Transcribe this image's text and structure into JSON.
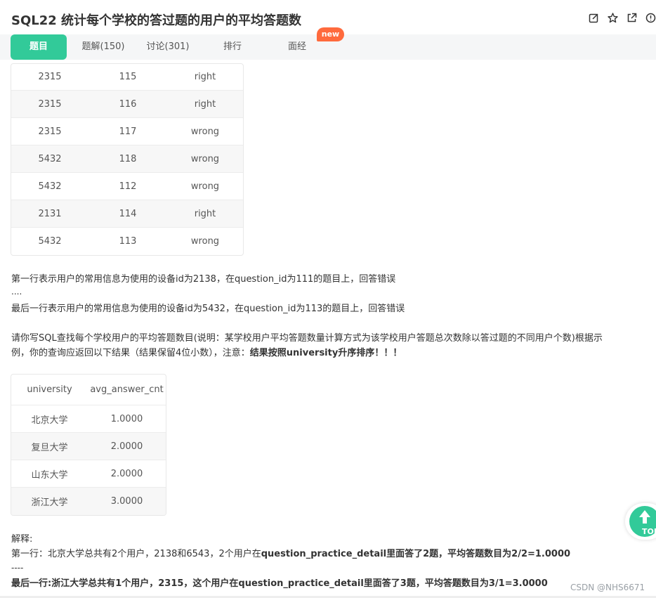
{
  "header": {
    "title": "SQL22  统计每个学校的答过题的用户的平均答题数"
  },
  "header_icons": [
    "edit-icon",
    "star-icon",
    "share-icon",
    "info-icon"
  ],
  "tabs": [
    {
      "label": "题目",
      "active": true
    },
    {
      "label": "题解(150)",
      "active": false
    },
    {
      "label": "讨论(301)",
      "active": false
    },
    {
      "label": "排行",
      "active": false
    },
    {
      "label": "面经",
      "active": false
    }
  ],
  "badge": "new",
  "table1": {
    "rows": [
      [
        "2315",
        "115",
        "right"
      ],
      [
        "2315",
        "116",
        "right"
      ],
      [
        "2315",
        "117",
        "wrong"
      ],
      [
        "5432",
        "118",
        "wrong"
      ],
      [
        "5432",
        "112",
        "wrong"
      ],
      [
        "2131",
        "114",
        "right"
      ],
      [
        "5432",
        "113",
        "wrong"
      ]
    ]
  },
  "description": {
    "line1": "第一行表示用户的常用信息为使用的设备id为2138，在question_id为111的题目上，回答错误",
    "line2": "....",
    "line3": "最后一行表示用户的常用信息为使用的设备id为5432，在question_id为113的题目上，回答错误",
    "request1": "请你写SQL查找每个学校用户的平均答题数目(说明：某学校用户平均答题数量计算方式为该学校用户答题总次数除以答过题的不同用户个数)根据示",
    "request2_prefix": "例，你的查询应返回以下结果（结果保留4位小数），注意：",
    "request2_bold": "结果按照university升序排序！！！"
  },
  "table2": {
    "headers": [
      "university",
      "avg_answer_cnt"
    ],
    "rows": [
      [
        "北京大学",
        "1.0000"
      ],
      [
        "复旦大学",
        "2.0000"
      ],
      [
        "山东大学",
        "2.0000"
      ],
      [
        "浙江大学",
        "3.0000"
      ]
    ]
  },
  "explanation": {
    "title": "解释:",
    "line1_prefix": "第一行：北京大学总共有2个用户，2138和6543，2个用户在",
    "line1_bold": "question_practice_detail里面答了2题，平均答题数目为2/2=1.0000",
    "line2": "----",
    "line3": "最后一行:浙江大学总共有1个用户，2315，这个用户在question_practice_detail里面答了3题，平均答题数目为3/1=3.0000"
  },
  "top_button": {
    "label": "TOP",
    "icon": "arrow-up-icon"
  },
  "watermark": "CSDN @NHS6671",
  "colors": {
    "accent": "#32ca99",
    "badge": "#ff6a3d"
  }
}
